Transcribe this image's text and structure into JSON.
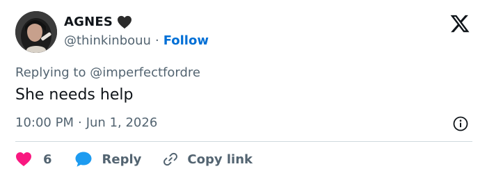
{
  "author": {
    "name": "AGNES",
    "handle": "@thinkinbouu",
    "separator": "·",
    "follow_label": "Follow"
  },
  "reply_context": {
    "prefix": "Replying to",
    "mention": "@imperfectfordre"
  },
  "tweet": {
    "text": "She needs help",
    "time": "10:00 PM",
    "separator": "·",
    "date": "Jun 1, 2026"
  },
  "actions": {
    "like_count": "6",
    "reply_label": "Reply",
    "copy_link_label": "Copy link"
  },
  "colors": {
    "like": "#f91880",
    "reply": "#1d9bf0",
    "follow": "#006fd6",
    "muted": "#536471",
    "text": "#0f1419",
    "divider": "#cfd9de"
  },
  "icons": {
    "badge": "black-heart-icon",
    "platform": "x-logo-icon",
    "info": "info-icon",
    "like": "heart-icon",
    "reply": "speech-bubble-icon",
    "copy_link": "link-icon"
  }
}
